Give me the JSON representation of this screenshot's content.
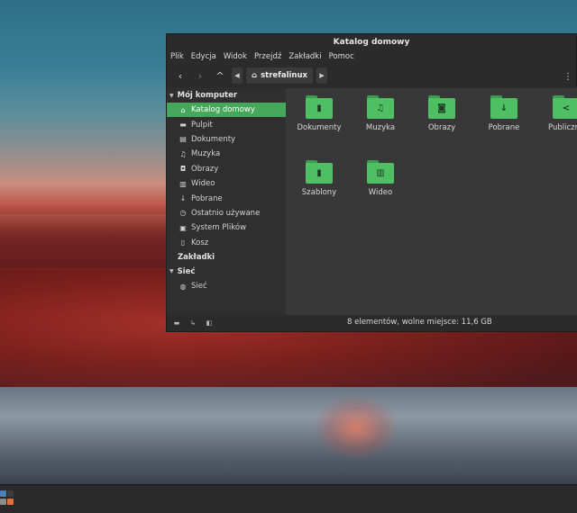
{
  "window": {
    "title": "Katalog domowy"
  },
  "menubar": [
    "Plik",
    "Edycja",
    "Widok",
    "Przejdź",
    "Zakładki",
    "Pomoc"
  ],
  "toolbar": {
    "back_icon": "‹",
    "forward_icon": "›",
    "up_icon": "^",
    "breadcrumb_label": "strefalinux",
    "menu_icon": "⋮"
  },
  "sidebar": {
    "sections": [
      {
        "label": "Mój komputer"
      },
      {
        "label": "Zakładki"
      },
      {
        "label": "Sieć"
      }
    ],
    "items": [
      {
        "label": "Katalog domowy",
        "icon": "home-icon",
        "glyph": "⌂"
      },
      {
        "label": "Pulpit",
        "icon": "desktop-icon",
        "glyph": "▬"
      },
      {
        "label": "Dokumenty",
        "icon": "document-icon",
        "glyph": "▤"
      },
      {
        "label": "Muzyka",
        "icon": "music-icon",
        "glyph": "♫"
      },
      {
        "label": "Obrazy",
        "icon": "camera-icon",
        "glyph": "◘"
      },
      {
        "label": "Wideo",
        "icon": "film-icon",
        "glyph": "▥"
      },
      {
        "label": "Pobrane",
        "icon": "download-icon",
        "glyph": "↓"
      },
      {
        "label": "Ostatnio używane",
        "icon": "clock-icon",
        "glyph": "◷"
      },
      {
        "label": "System Plików",
        "icon": "drive-icon",
        "glyph": "▣"
      },
      {
        "label": "Kosz",
        "icon": "trash-icon",
        "glyph": "▯"
      },
      {
        "label": "Sieć",
        "icon": "network-icon",
        "glyph": "◍"
      }
    ]
  },
  "folders": [
    {
      "label": "Dokumenty",
      "icon": "document-icon",
      "glyph": "▮"
    },
    {
      "label": "Muzyka",
      "icon": "music-icon",
      "glyph": "♫"
    },
    {
      "label": "Obrazy",
      "icon": "camera-icon",
      "glyph": "◙"
    },
    {
      "label": "Pobrane",
      "icon": "download-icon",
      "glyph": "↓"
    },
    {
      "label": "Publiczne",
      "icon": "share-icon",
      "glyph": "<"
    },
    {
      "label": "Szablony",
      "icon": "template-icon",
      "glyph": "▮"
    },
    {
      "label": "Wideo",
      "icon": "film-icon",
      "glyph": "▥"
    }
  ],
  "status": {
    "text": "8 elementów, wolne miejsce: 11,6 GB"
  },
  "colors": {
    "accent": "#44a75a",
    "folder": "#4fbf64"
  }
}
